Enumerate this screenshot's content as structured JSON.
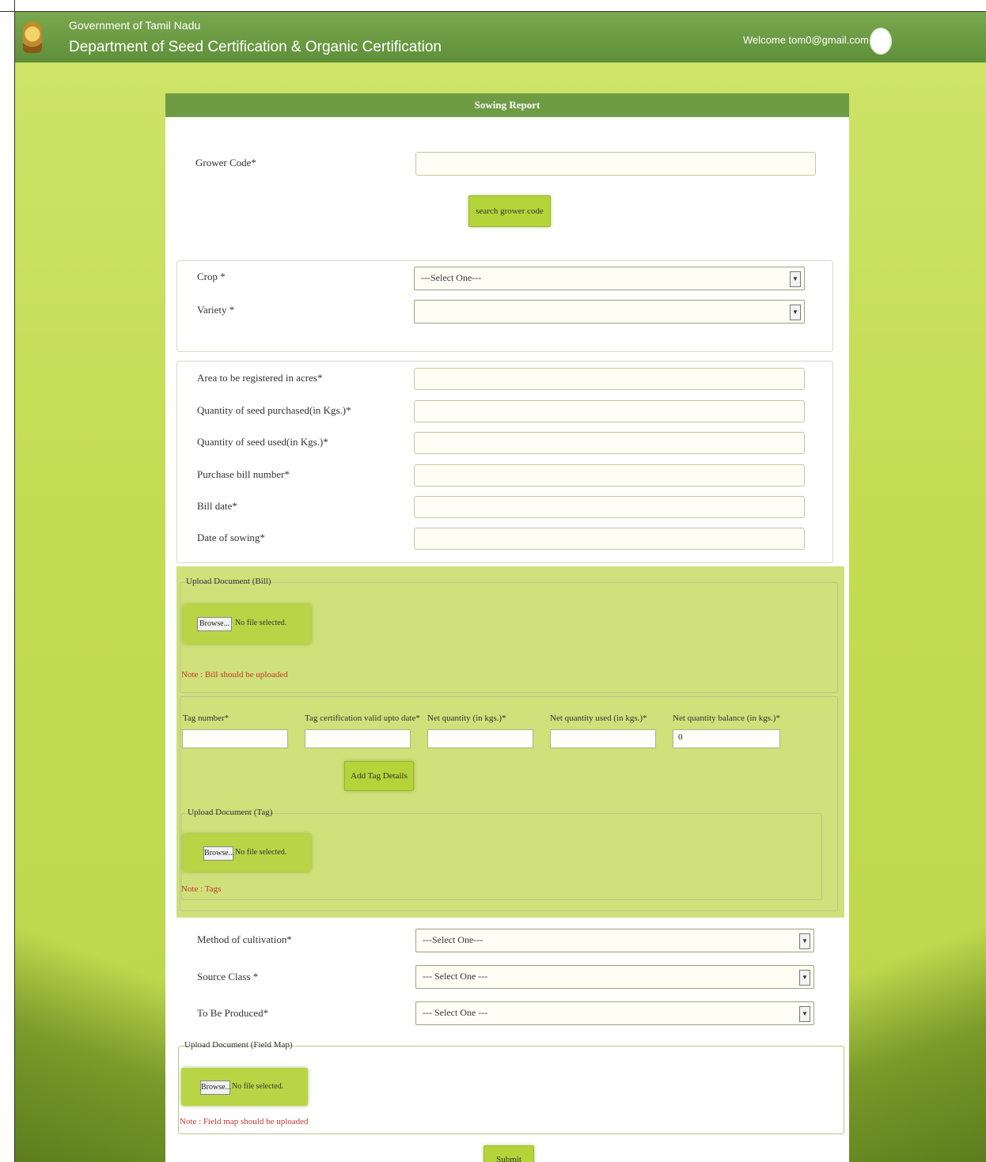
{
  "header": {
    "government": "Government of Tamil Nadu",
    "department": "Department of Seed Certification & Organic Certification",
    "welcome": "Welcome tom0@gmail.com"
  },
  "form": {
    "title": "Sowing Report",
    "grower_code_label": "Grower Code*",
    "grower_code_value": "",
    "search_button": "search grower code",
    "crop_label": "Crop *",
    "crop_value": "---Select One---",
    "variety_label": "Variety *",
    "variety_value": "",
    "area_label": "Area to be registered in acres*",
    "qty_purchased_label": "Quantity of seed purchased(in Kgs.)*",
    "qty_used_label": "Quantity of seed used(in Kgs.)*",
    "bill_number_label": "Purchase bill number*",
    "bill_date_label": "Bill date*",
    "sowing_date_label": "Date of sowing*",
    "upload_bill_legend": "Upload Document (Bill)",
    "browse_label": "Browse...",
    "no_file_label": "No file selected.",
    "bill_note": "Note : Bill should be uploaded",
    "tag_number_label": "Tag number*",
    "tag_validity_label": "Tag certification valid upto date*",
    "net_qty_label": "Net quantity (in kgs.)*",
    "net_qty_used_label": "Net quantity used (in kgs.)*",
    "net_qty_balance_label": "Net quantity balance (in kgs.)*",
    "net_qty_balance_value": "0",
    "add_tag_button": "Add Tag Details",
    "upload_tag_legend": "Upload Document (Tag)",
    "tag_note": "Note : Tags",
    "cultivation_label": "Method of cultivation*",
    "cultivation_value": "---Select One---",
    "source_class_label": "Source Class *",
    "source_class_value": "--- Select One ---",
    "produced_label": "To Be Produced*",
    "produced_value": "--- Select One ---",
    "upload_fieldmap_legend": "Upload Document (Field Map)",
    "fieldmap_note": "Note : Field map should be uploaded",
    "submit_button": "Submit"
  },
  "colors": {
    "header_green": "#6f9b45",
    "background_lime": "#c9de58",
    "button_lime": "#b5d43a",
    "note_red": "#c0392b"
  }
}
